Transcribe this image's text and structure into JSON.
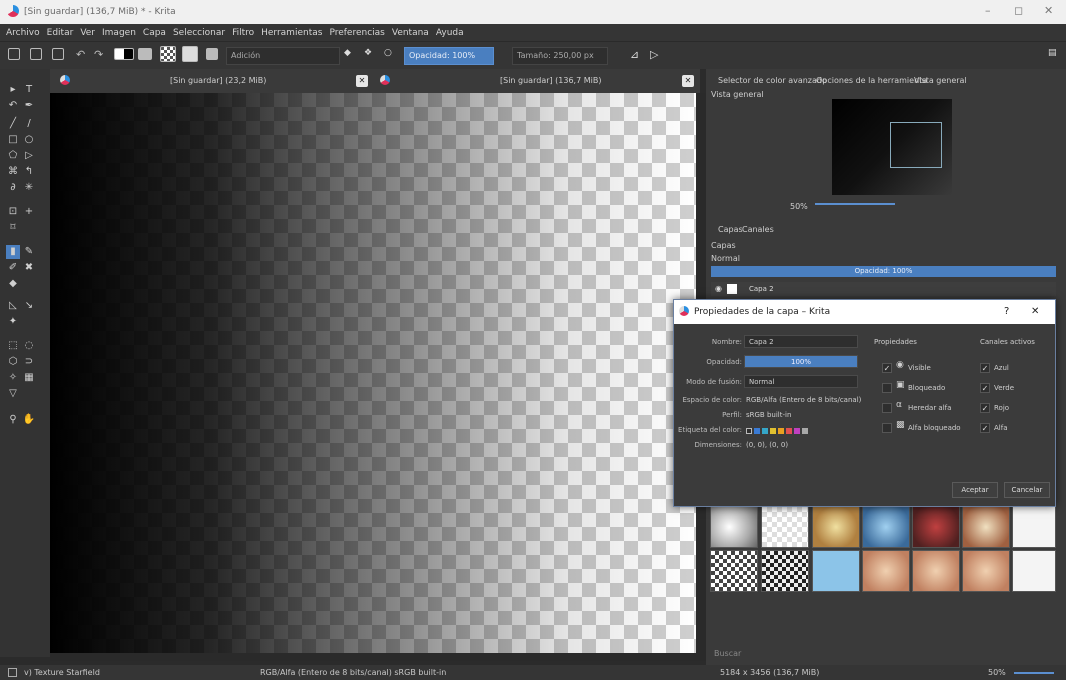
{
  "window": {
    "title": "[Sin guardar] (136,7 MiB) * - Krita",
    "minimize": "–",
    "maximize": "◻",
    "close": "✕"
  },
  "menu": [
    "Archivo",
    "Editar",
    "Ver",
    "Imagen",
    "Capa",
    "Seleccionar",
    "Filtro",
    "Herramientas",
    "Preferencias",
    "Ventana",
    "Ayuda"
  ],
  "toolbar": {
    "blend_mode": "Adición",
    "opacity": "Opacidad: 100%",
    "size": "Tamaño: 250,00 px"
  },
  "tabs": [
    {
      "label": "[Sin guardar] (23,2 MiB)",
      "close": "✕"
    },
    {
      "label": "[Sin guardar] (136,7 MiB)",
      "close": "✕"
    }
  ],
  "dock": {
    "tabs": [
      "Selector de color avanzado",
      "Opciones de la herramienta",
      "Vista general"
    ],
    "overview_title": "Vista general",
    "zoom": "50%",
    "layer_tabs": [
      "Capas",
      "Canales"
    ],
    "layers_title": "Capas",
    "layer_blend": "Normal",
    "layer_opacity": "Opacidad: 100%",
    "layer_name": "Capa 2",
    "search_placeholder": "Buscar"
  },
  "dialog": {
    "title": "Propiedades de la capa – Krita",
    "help": "?",
    "close": "✕",
    "name_label": "Nombre:",
    "name_value": "Capa 2",
    "opacity_label": "Opacidad:",
    "opacity_value": "100%",
    "blend_label": "Modo de fusión:",
    "blend_value": "Normal",
    "colorspace_label": "Espacio de color:",
    "colorspace_value": "RGB/Alfa (Entero de 8 bits/canal)",
    "profile_label": "Perfil:",
    "profile_value": "sRGB built-in",
    "color_label_label": "Etiqueta del color:",
    "dimensions_label": "Dimensiones:",
    "dimensions_value": "(0, 0), (0, 0)",
    "properties_title": "Propiedades",
    "properties": [
      {
        "label": "Visible",
        "checked": true
      },
      {
        "label": "Bloqueado",
        "checked": false
      },
      {
        "label": "Heredar alfa",
        "checked": false
      },
      {
        "label": "Alfa bloqueado",
        "checked": false
      }
    ],
    "channels_title": "Canales activos",
    "channels": [
      {
        "label": "Azul",
        "checked": true
      },
      {
        "label": "Verde",
        "checked": true
      },
      {
        "label": "Rojo",
        "checked": true
      },
      {
        "label": "Alfa",
        "checked": true
      }
    ],
    "ok": "Aceptar",
    "cancel": "Cancelar",
    "swatch_colors": [
      "#3a7bd5",
      "#35a6c8",
      "#e0c030",
      "#e8a020",
      "#e05050",
      "#c040c0",
      "#a8a8a8"
    ]
  },
  "status": {
    "brush": "v) Texture Starfield",
    "colorspace": "RGB/Alfa (Entero de 8 bits/canal)  sRGB built-in",
    "image_size": "5184 x 3456 (136,7 MiB)",
    "zoom": "50%"
  },
  "colors": {
    "accent": "#4a7fc0"
  }
}
